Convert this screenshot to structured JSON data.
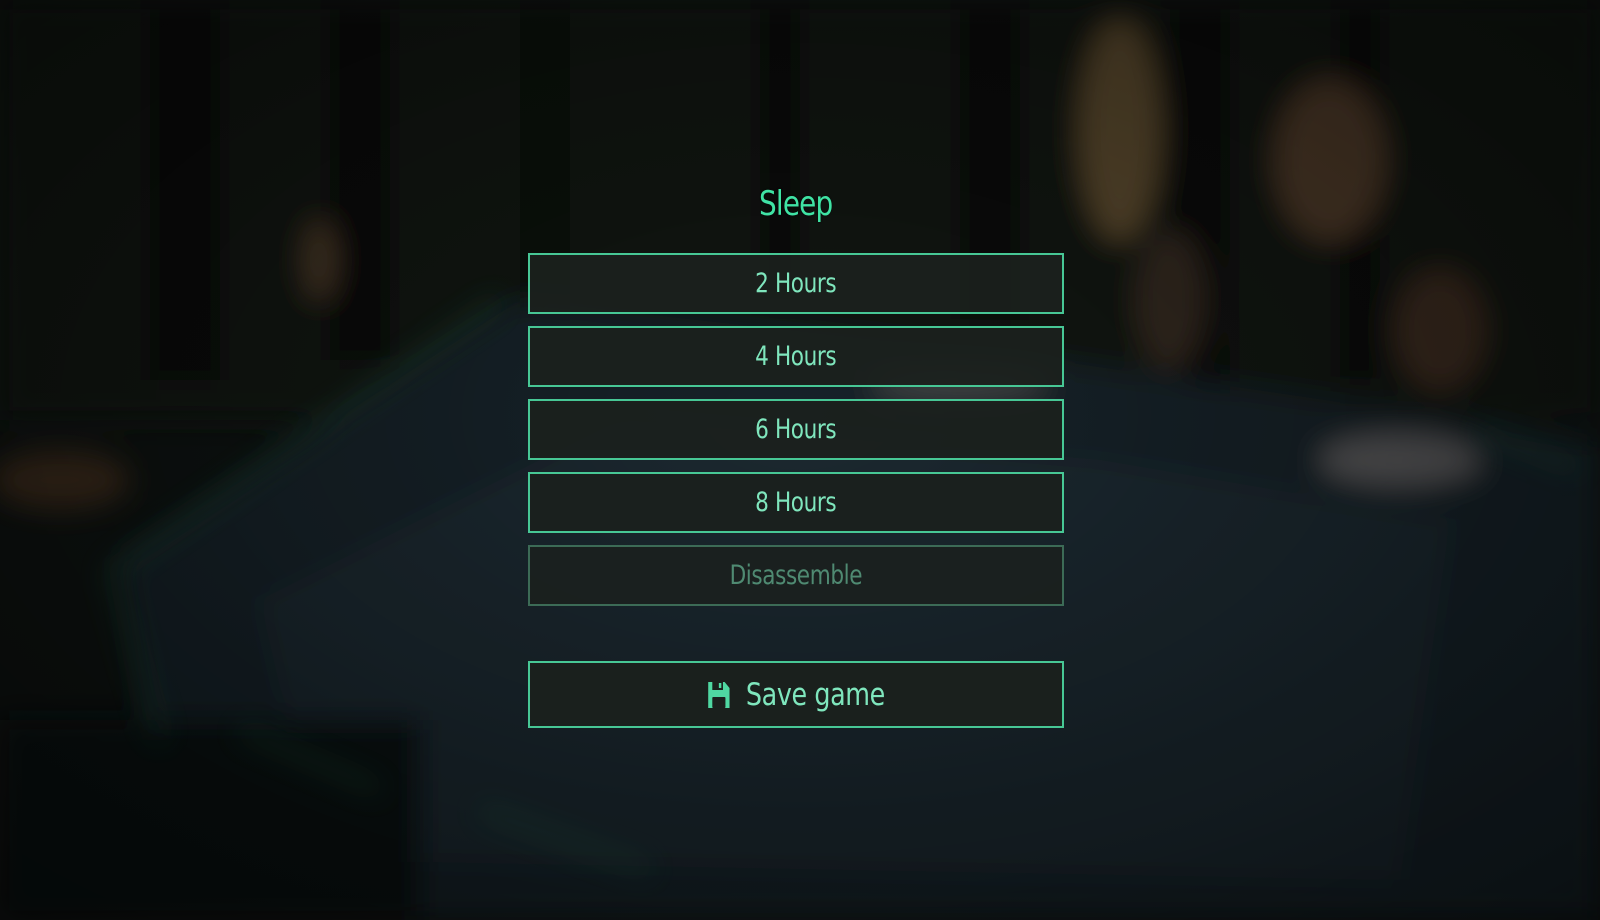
{
  "menu": {
    "title": "Sleep",
    "options": [
      {
        "label": "2 Hours",
        "enabled": true
      },
      {
        "label": "4 Hours",
        "enabled": true
      },
      {
        "label": "6 Hours",
        "enabled": true
      },
      {
        "label": "8 Hours",
        "enabled": true
      },
      {
        "label": "Disassemble",
        "enabled": false
      }
    ],
    "save": {
      "label": "Save game",
      "icon": "floppy-disk-icon"
    }
  },
  "colors": {
    "accent": "#3fe3a4",
    "button_border": "#47c795",
    "button_text": "#7fe6bd",
    "disabled_border": "#3c6b56",
    "disabled_text": "#4f8a72",
    "button_bg": "#1b201d"
  }
}
